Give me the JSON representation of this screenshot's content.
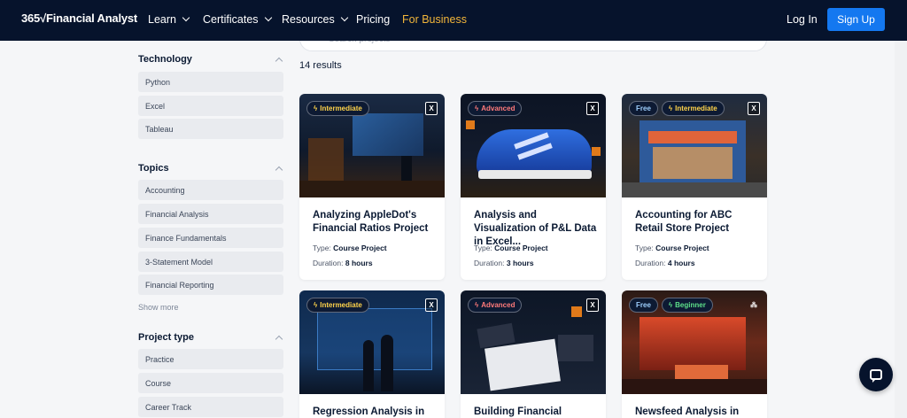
{
  "nav": {
    "logo": "365√Financial Analyst",
    "items": [
      "Learn",
      "Certificates",
      "Resources",
      "Pricing",
      "For Business"
    ],
    "login": "Log In",
    "signup": "Sign Up",
    "colors": {
      "background": "#06132c",
      "accent": "#1478f0",
      "business": "#f2b63a"
    }
  },
  "search": {
    "placeholder": "Search projects"
  },
  "results_label": "14 results",
  "sidebar": {
    "technology": {
      "title": "Technology",
      "items": [
        "Python",
        "Excel",
        "Tableau"
      ]
    },
    "topics": {
      "title": "Topics",
      "items": [
        "Accounting",
        "Financial Analysis",
        "Finance Fundamentals",
        "3-Statement Model",
        "Financial Reporting"
      ],
      "show_more": "Show more"
    },
    "project_type": {
      "title": "Project type",
      "items": [
        "Practice",
        "Course",
        "Career Track"
      ]
    }
  },
  "type_label": "Type:",
  "duration_label": "Duration:",
  "cards": [
    {
      "badges": [
        "Intermediate"
      ],
      "title": "Analyzing AppleDot's Financial Ratios Project",
      "type": "Course Project",
      "duration": "8 hours",
      "icon": "excel-icon"
    },
    {
      "badges": [
        "Advanced"
      ],
      "title": "Analysis and Visualization of P&L Data in Excel...",
      "type": "Course Project",
      "duration": "3 hours",
      "icon": "excel-icon"
    },
    {
      "badges": [
        "Free",
        "Intermediate"
      ],
      "title": "Accounting for ABC Retail Store Project",
      "type": "Course Project",
      "duration": "4 hours",
      "icon": "excel-icon"
    },
    {
      "badges": [
        "Intermediate"
      ],
      "title": "Regression Analysis in",
      "icon": "excel-icon"
    },
    {
      "badges": [
        "Advanced"
      ],
      "title": "Building Financial",
      "icon": "excel-icon"
    },
    {
      "badges": [
        "Free",
        "Beginner"
      ],
      "title": "Newsfeed Analysis in",
      "icon": "python-icon"
    }
  ]
}
